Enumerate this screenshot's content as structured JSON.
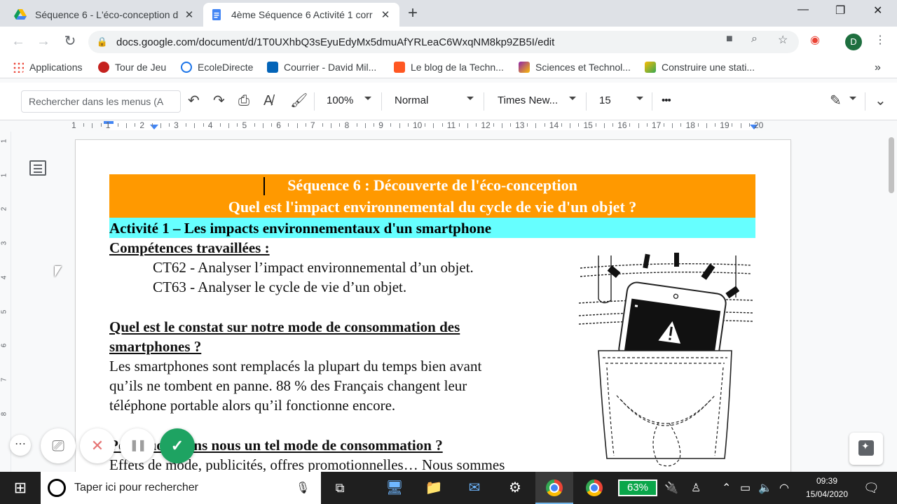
{
  "browser": {
    "tabs": [
      {
        "title": "Séquence 6 - L'éco-conception d",
        "close": "✕",
        "favicon": "drive-icon",
        "active": false
      },
      {
        "title": "4ème Séquence 6 Activité 1 corr",
        "close": "✕",
        "favicon": "docs-icon",
        "active": true
      }
    ],
    "new_tab": "+",
    "window_controls": {
      "minimize": "—",
      "maximize": "❐",
      "close": "✕"
    },
    "nav": {
      "back": "←",
      "forward": "→",
      "reload": "↻"
    },
    "url": "docs.google.com/document/d/1T0UXhbQ3sEyuEdyMx5dmuAfYRLeaC6WxqNM8kp9ZB5I/edit",
    "profile_initial": "D",
    "menu": "⋮"
  },
  "bookmarks": {
    "items": [
      {
        "label": "Applications",
        "color": "#ea4335"
      },
      {
        "label": "Tour de Jeu",
        "color": "#c5221f"
      },
      {
        "label": "EcoleDirecte",
        "color": "#1a73e8"
      },
      {
        "label": "Courrier - David Mil...",
        "color": "#0364b8"
      },
      {
        "label": "Le blog de la Techn...",
        "color": "#ff5722"
      },
      {
        "label": "Sciences et Technol...",
        "color": "#8e24aa"
      },
      {
        "label": "Construire une stati...",
        "color": "#fbbc04"
      }
    ],
    "more": "»"
  },
  "docs_toolbar": {
    "menu_search_placeholder": "Rechercher dans les menus (A",
    "zoom": "100%",
    "style": "Normal",
    "font": "Times New...",
    "font_size": "15",
    "more": "•••"
  },
  "ruler": {
    "numbers": [
      "1",
      "1",
      "2",
      "3",
      "4",
      "5",
      "6",
      "7",
      "8",
      "9",
      "10",
      "11",
      "12",
      "13",
      "14",
      "15",
      "16",
      "17",
      "18",
      "19",
      "20"
    ]
  },
  "vruler": {
    "numbers": [
      "1",
      "1",
      "2",
      "3",
      "4",
      "5",
      "6",
      "7",
      "8"
    ]
  },
  "document": {
    "banner_line1": "Séquence 6 : Découverte de l'éco-conception",
    "banner_line2": "Quel est l'impact environnemental du cycle de vie d'un objet ?",
    "activity": "Activité 1 – Les impacts environnementaux d'un smartphone",
    "competences_heading": "Compétences travaillées :",
    "ct62": "CT62 - Analyser l’impact environnemental d’un objet.",
    "ct63": "CT63 - Analyser le cycle de vie d’un objet.",
    "q1_line1": "Quel est le constat sur notre mode de consommation des",
    "q1_line2": "smartphones ?",
    "p1_line1": "Les smartphones sont remplacés la plupart du temps bien avant",
    "p1_line2": "qu’ils ne tombent en panne. 88 % des Français changent leur",
    "p1_line3": "téléphone portable alors qu’il fonctionne encore.",
    "q2_line1": "Pourquoi avons nous un tel mode de consommation ?",
    "p2_line1": "Effets de mode, publicités, offres promotionnelles… Nous sommes",
    "colors": {
      "banner": "#ff9900",
      "activity": "#66ffff"
    }
  },
  "recorder": {
    "more": "⋯",
    "camera": "⎚",
    "cancel": "✕",
    "pause": "❚❚",
    "done": "✓"
  },
  "taskbar": {
    "start": "⊞",
    "search_placeholder": "Taper ici pour rechercher",
    "battery": "63%",
    "time": "09:39",
    "date": "15/04/2020"
  }
}
